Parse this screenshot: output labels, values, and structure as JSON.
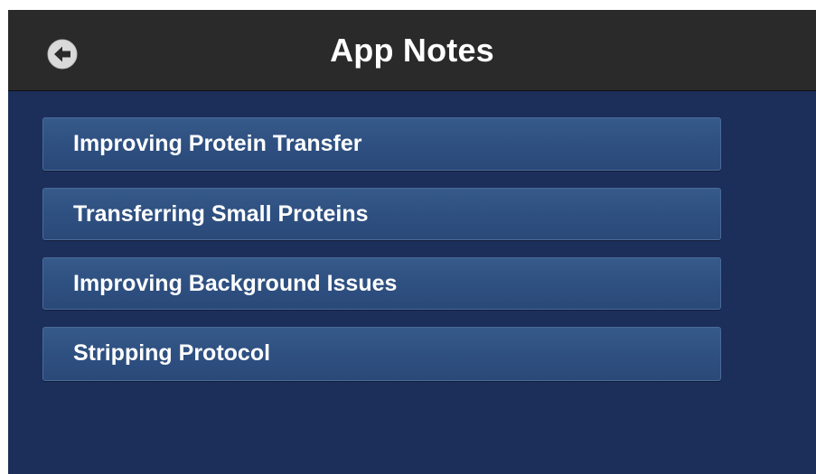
{
  "header": {
    "title": "App Notes",
    "back_icon": "back-arrow-icon"
  },
  "notes": [
    {
      "label": "Improving Protein Transfer"
    },
    {
      "label": "Transferring Small Proteins"
    },
    {
      "label": "Improving Background Issues"
    },
    {
      "label": "Stripping Protocol"
    }
  ],
  "colors": {
    "header_bg": "#2a2a2a",
    "screen_bg": "#1c2e5a",
    "button_bg": "#2e5081",
    "text": "#ffffff"
  }
}
